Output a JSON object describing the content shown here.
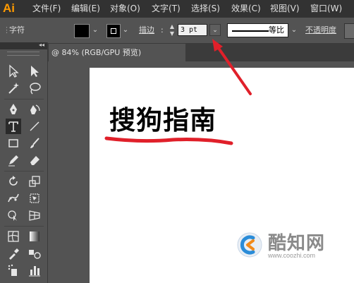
{
  "app": {
    "logo": "Ai"
  },
  "menu": [
    "文件(F)",
    "编辑(E)",
    "对象(O)",
    "文字(T)",
    "选择(S)",
    "效果(C)",
    "视图(V)",
    "窗口(W)"
  ],
  "controlbar": {
    "panel_label": "字符",
    "stroke_label": "描边",
    "stroke_weight": "3 pt",
    "profile_label": "等比",
    "opacity_label": "不透明度"
  },
  "document_tab": {
    "title": "@ 84% (RGB/GPU 预览)"
  },
  "toolbar": {
    "collapse": "◂◂",
    "tools": [
      "selection-tool-icon",
      "direct-selection-tool-icon",
      "magic-wand-tool-icon",
      "lasso-tool-icon",
      "pen-tool-icon",
      "curvature-tool-icon",
      "type-tool-icon",
      "line-tool-icon",
      "rectangle-tool-icon",
      "paintbrush-tool-icon",
      "pencil-tool-icon",
      "eraser-tool-icon",
      "rotate-tool-icon",
      "scale-tool-icon",
      "puppet-warp-tool-icon",
      "free-transform-tool-icon",
      "shape-builder-tool-icon",
      "perspective-grid-tool-icon",
      "mesh-tool-icon",
      "gradient-tool-icon",
      "eyedropper-tool-icon",
      "blend-tool-icon",
      "symbol-sprayer-tool-icon",
      "column-graph-tool-icon"
    ]
  },
  "canvas": {
    "text": "搜狗指南"
  },
  "annotations": {
    "underline_color": "#e0202a",
    "arrow_color": "#e0202a"
  },
  "watermark": {
    "name": "酷知网",
    "url": "www.coozhi.com"
  },
  "colors": {
    "menubar": "#323232",
    "ui_bg": "#535353",
    "logo": "#ff9a00",
    "artboard": "#ffffff"
  }
}
